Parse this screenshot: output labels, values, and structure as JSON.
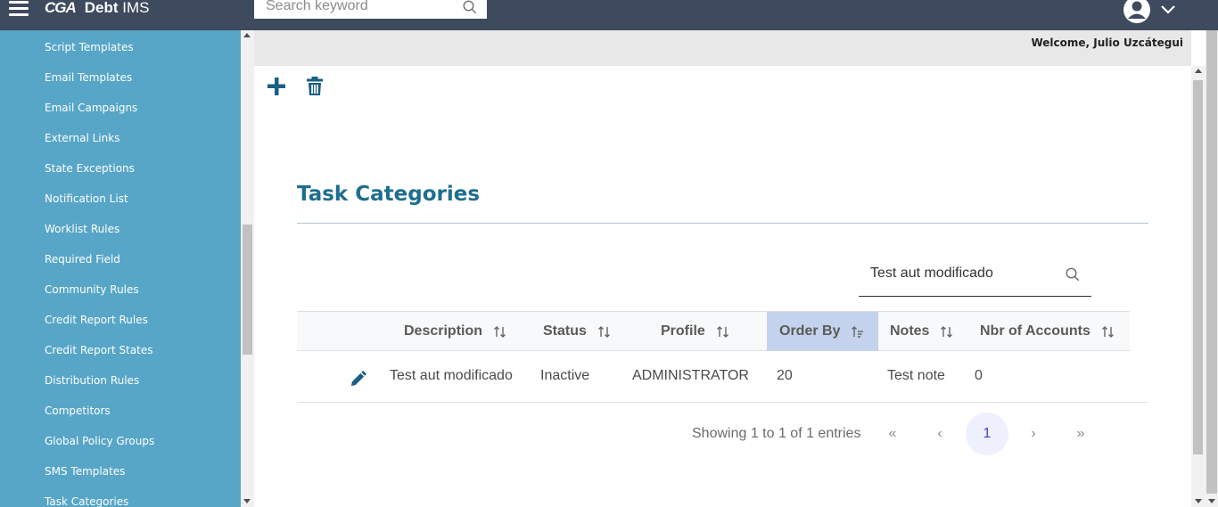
{
  "header": {
    "logo_mark": "CGA",
    "app_name_bold": "Debt",
    "app_name_rest": " IMS",
    "search_placeholder": "Search keyword"
  },
  "sidebar": {
    "items": [
      {
        "label": "Script Templates"
      },
      {
        "label": "Email Templates"
      },
      {
        "label": "Email Campaigns"
      },
      {
        "label": "External Links"
      },
      {
        "label": "State Exceptions"
      },
      {
        "label": "Notification List"
      },
      {
        "label": "Worklist Rules"
      },
      {
        "label": "Required Field"
      },
      {
        "label": "Community Rules"
      },
      {
        "label": "Credit Report Rules"
      },
      {
        "label": "Credit Report States"
      },
      {
        "label": "Distribution Rules"
      },
      {
        "label": "Competitors"
      },
      {
        "label": "Global Policy Groups"
      },
      {
        "label": "SMS Templates"
      },
      {
        "label": "Task Categories"
      }
    ]
  },
  "welcome_text": "Welcome, Julio Uzcátegui",
  "page_title": "Task Categories",
  "table_search_value": "Test aut modificado",
  "table": {
    "columns": [
      {
        "label": "Description"
      },
      {
        "label": "Status"
      },
      {
        "label": "Profile"
      },
      {
        "label": "Order By",
        "sorted": "ascending"
      },
      {
        "label": "Notes"
      },
      {
        "label": "Nbr of Accounts"
      }
    ],
    "rows": [
      {
        "description": "Test aut modificado",
        "status": "Inactive",
        "profile": "ADMINISTRATOR",
        "order_by": "20",
        "notes": "Test note",
        "nbr_accounts": "0"
      }
    ]
  },
  "pagination": {
    "info": "Showing 1 to 1 of 1 entries",
    "first": "«",
    "prev": "‹",
    "current_page": "1",
    "next": "›",
    "last": "»"
  },
  "colors": {
    "topbar": "#3e4a5e",
    "sidebar": "#57a6c7",
    "title": "#1e6e8e",
    "active_header": "#c4d3ed",
    "current_page": "#4b3bd6",
    "toolbar_icons": "#1a5f86"
  }
}
